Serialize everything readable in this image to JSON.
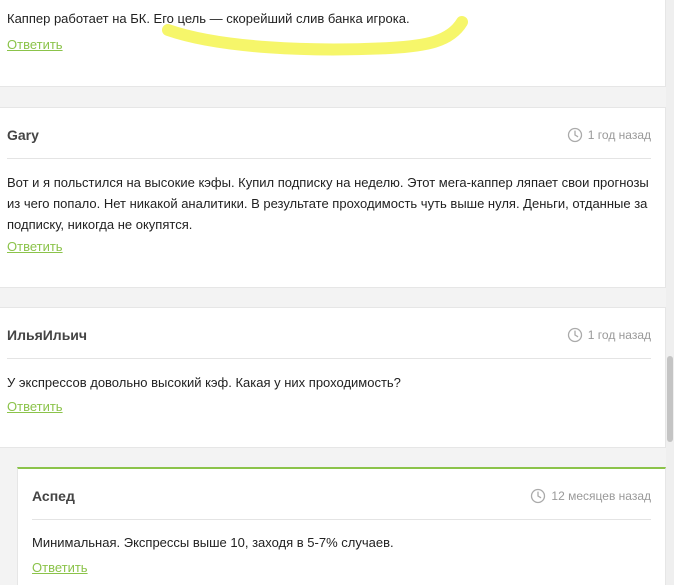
{
  "top_comment": {
    "text": "Каппер работает на БК. Его цель — скорейший слив банка игрока.",
    "reply_label": "Ответить"
  },
  "comments": [
    {
      "author": "Gary",
      "time": "1 год назад",
      "text": "Вот и я польстился на высокие кэфы. Купил подписку на неделю. Этот мега-каппер ляпает свои прогнозы из чего попало. Нет никакой аналитики. В результате проходимость чуть выше нуля. Деньги, отданные за подписку, никогда не окупятся.",
      "reply_label": "Ответить"
    },
    {
      "author": "ИльяИльич",
      "time": "1 год назад",
      "text": "У экспрессов довольно высокий кэф. Какая у них проходимость?",
      "reply_label": "Ответить"
    }
  ],
  "reply": {
    "author": "Аспед",
    "time": "12 месяцев назад",
    "text": "Минимальная. Экспрессы выше 10, заходя в 5-7% случаев.",
    "reply_label": "Ответить"
  },
  "colors": {
    "accent": "#8bc34a",
    "highlight": "#f5f55a"
  },
  "icons": {
    "time": "clock-icon"
  }
}
